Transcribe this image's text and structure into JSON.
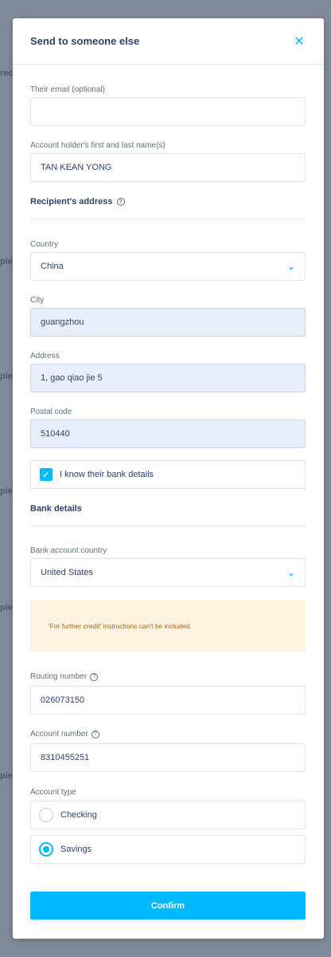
{
  "modal": {
    "title": "Send to someone else",
    "close_icon": "close-icon"
  },
  "fields": {
    "email": {
      "label": "Their email (optional)",
      "value": ""
    },
    "name": {
      "label": "Account holder's first and last name(s)",
      "value": "TAN KEAN YONG"
    },
    "address_section": "Recipient's address",
    "country": {
      "label": "Country",
      "value": "China"
    },
    "city": {
      "label": "City",
      "value": "guangzhou"
    },
    "address": {
      "label": "Address",
      "value": "1, gao qiao jie 5"
    },
    "postal": {
      "label": "Postal code",
      "value": "510440"
    },
    "bank_checkbox": {
      "label": "I know their bank details",
      "checked": true
    },
    "bank_section": "Bank details",
    "bank_country": {
      "label": "Bank account country",
      "value": "United States"
    },
    "alert": "'For further credit' instructions can't be included.",
    "routing": {
      "label": "Routing number",
      "value": "026073150"
    },
    "account": {
      "label": "Account number",
      "value": "8310455251"
    },
    "account_type": {
      "label": "Account type",
      "options": [
        "Checking",
        "Savings"
      ],
      "selected": "Savings"
    }
  },
  "confirm_label": "Confirm",
  "colors": {
    "accent": "#00b9ff",
    "title": "#2e4369",
    "filled_input": "#e8eefc",
    "alert_bg": "#fff2de",
    "alert_text": "#9c6a19"
  }
}
